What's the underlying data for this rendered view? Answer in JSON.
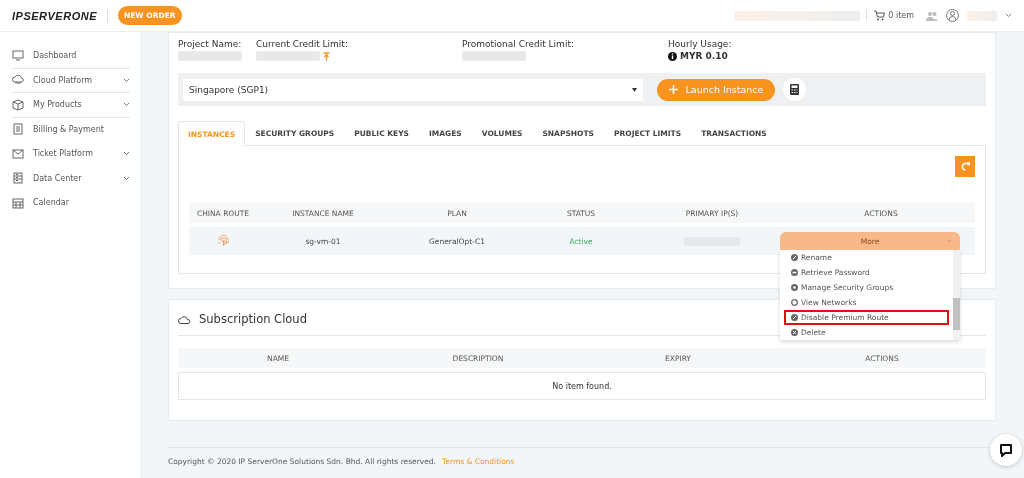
{
  "header": {
    "logo": "IPSERVERONE",
    "new_order_button": "NEW ORDER",
    "cart": "0 item"
  },
  "sidebar": {
    "items": [
      {
        "label": "Dashboard",
        "expandable": false
      },
      {
        "label": "Cloud Platform",
        "expandable": true
      },
      {
        "label": "My Products",
        "expandable": true
      },
      {
        "label": "Billing & Payment",
        "expandable": false
      },
      {
        "label": "Ticket Platform",
        "expandable": true
      },
      {
        "label": "Data Center",
        "expandable": true
      },
      {
        "label": "Calendar",
        "expandable": false
      }
    ]
  },
  "project_info": [
    {
      "label": "Project Name:",
      "kind": "redacted"
    },
    {
      "label": "Current Credit Limit:",
      "kind": "redacted_pin"
    },
    {
      "label": "Promotional Credit Limit:",
      "kind": "redacted"
    },
    {
      "label": "Hourly Usage:",
      "kind": "value",
      "value": "MYR 0.10"
    }
  ],
  "region_select": {
    "value": "Singapore (SGP1)"
  },
  "launch_button": "Launch Instance",
  "tabs": [
    {
      "label": "INSTANCES",
      "selected": true
    },
    {
      "label": "SECURITY GROUPS",
      "selected": false
    },
    {
      "label": "PUBLIC KEYS",
      "selected": false
    },
    {
      "label": "IMAGES",
      "selected": false
    },
    {
      "label": "VOLUMES",
      "selected": false
    },
    {
      "label": "SNAPSHOTS",
      "selected": false
    },
    {
      "label": "PROJECT LIMITS",
      "selected": false
    },
    {
      "label": "TRANSACTIONS",
      "selected": false
    }
  ],
  "instances_table": {
    "columns": [
      "CHINA ROUTE",
      "INSTANCE NAME",
      "PLAN",
      "STATUS",
      "PRIMARY IP(S)",
      "ACTIONS"
    ],
    "rows": [
      {
        "instance_name": "sg-vm-01",
        "plan": "GeneralOpt-C1",
        "status": "Active",
        "actions_button": "More"
      }
    ]
  },
  "actions_menu": {
    "items": [
      {
        "label": "Rename",
        "highlighted": false
      },
      {
        "label": "Retrieve Password",
        "highlighted": false
      },
      {
        "label": "Manage Security Groups",
        "highlighted": false
      },
      {
        "label": "View Networks",
        "highlighted": false
      },
      {
        "label": "Disable Premium Route",
        "highlighted": true
      },
      {
        "label": "Delete",
        "highlighted": false
      }
    ]
  },
  "subscription": {
    "title": "Subscription Cloud",
    "columns": [
      "NAME",
      "DESCRIPTION",
      "EXPIRY",
      "ACTIONS"
    ],
    "empty_message": "No item found."
  },
  "footer": {
    "copyright": "Copyright © 2020 IP ServerOne Solutions Sdn. Bhd. All rights reserved.",
    "link": "Terms & Conditions"
  }
}
